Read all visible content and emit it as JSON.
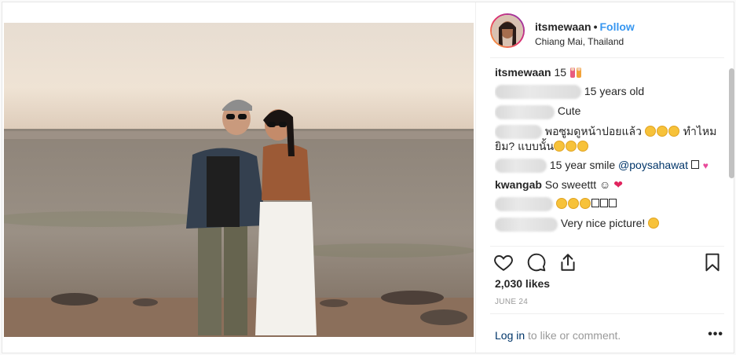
{
  "post": {
    "username": "itsmewaan",
    "follow_label": "Follow",
    "separator": "•",
    "location": "Chiang Mai, Thailand"
  },
  "comments": [
    {
      "user": "itsmewaan",
      "text": "15",
      "blurred_user": false,
      "emoji": "dolls-emoji"
    },
    {
      "user": "",
      "text": "15 years old",
      "blurred_user": true
    },
    {
      "user": "",
      "text": "Cute",
      "blurred_user": true
    },
    {
      "user": "",
      "text": "พอซูมดูหน้าปอยแล้ว",
      "text2": "ทำไหม",
      "text3": "ยิม? แบบนั้น",
      "blurred_user": true
    },
    {
      "user": "",
      "text": "15 year smile",
      "mention": "@poysahawat",
      "blurred_user": true
    },
    {
      "user": "kwangab",
      "text": "So sweettt ☺",
      "heart": "❤",
      "blurred_user": false
    },
    {
      "user": "",
      "text": "",
      "blurred_user": true
    },
    {
      "user": "",
      "text": "Very nice picture!",
      "blurred_user": true
    }
  ],
  "likes": "2,030 likes",
  "date": "JUNE 24",
  "login": {
    "link": "Log in",
    "rest": " to like or comment."
  },
  "more_label": "•••",
  "icons": {
    "like": "heart-icon",
    "comment": "comment-icon",
    "share": "share-icon",
    "save": "bookmark-icon"
  },
  "colors": {
    "follow": "#3897f0",
    "mention": "#003569",
    "muted": "#999999"
  }
}
